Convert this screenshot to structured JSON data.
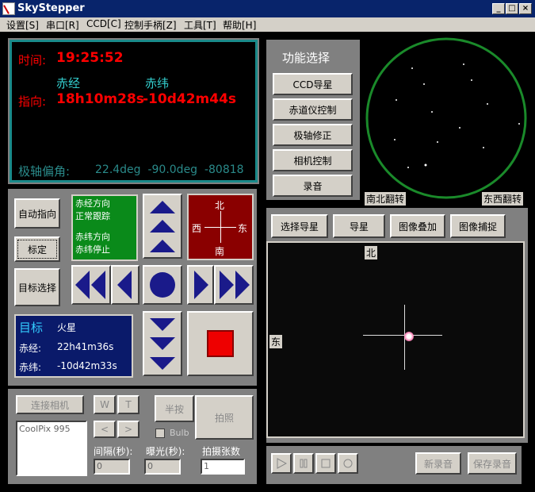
{
  "window": {
    "title": "SkyStepper",
    "min": "_",
    "max": "□",
    "close": "×"
  },
  "menu": [
    "设置[S]",
    "串口[R]",
    "CCD[C]",
    "控制手柄[Z]",
    "工具[T]",
    "帮助[H]"
  ],
  "status": {
    "time_label": "时间:",
    "time_value": "19:25:52",
    "ra_header": "赤经",
    "dec_header": "赤纬",
    "point_label": "指向:",
    "point_ra": "18h10m28s",
    "point_dec": "-10d42m44s",
    "polar_label": "极轴偏角:",
    "polar_values": "22.4deg  -90.0deg  -80818"
  },
  "left_buttons": {
    "auto": "自动指向",
    "calibrate": "标定",
    "target_select": "目标选择"
  },
  "motion_status": {
    "ra_dir": "赤经方向",
    "ra_state": "正常跟踪",
    "dec_dir": "赤纬方向",
    "dec_state": "赤纬停止"
  },
  "compass": {
    "n": "北",
    "s": "南",
    "w": "西",
    "e": "东"
  },
  "target": {
    "label": "目标",
    "name": "火星",
    "ra_label": "赤经:",
    "ra": "22h41m36s",
    "dec_label": "赤纬:",
    "dec": "-10d42m33s"
  },
  "function": {
    "title": "功能选择",
    "buttons": [
      "CCD导星",
      "赤道仪控制",
      "极轴修正",
      "相机控制",
      "录音"
    ]
  },
  "sky_view": {
    "flip_ns": "南北翻转",
    "flip_ew": "东西翻转"
  },
  "tabs": [
    "选择导星",
    "导星",
    "图像叠加",
    "图像捕捉"
  ],
  "ccd_view": {
    "north": "北",
    "east": "东"
  },
  "camera": {
    "connect": "连接相机",
    "w": "W",
    "t": "T",
    "left": "<",
    "right": ">",
    "half_press": "半按",
    "shoot": "拍照",
    "bulb": "Bulb",
    "camera_list": "CoolPix 995",
    "interval_label": "间隔(秒):",
    "exposure_label": "曝光(秒):",
    "count_label": "拍摄张数",
    "interval": "0",
    "exposure": "0",
    "count": "1"
  },
  "recorder": {
    "new": "新录音",
    "save": "保存录音"
  }
}
